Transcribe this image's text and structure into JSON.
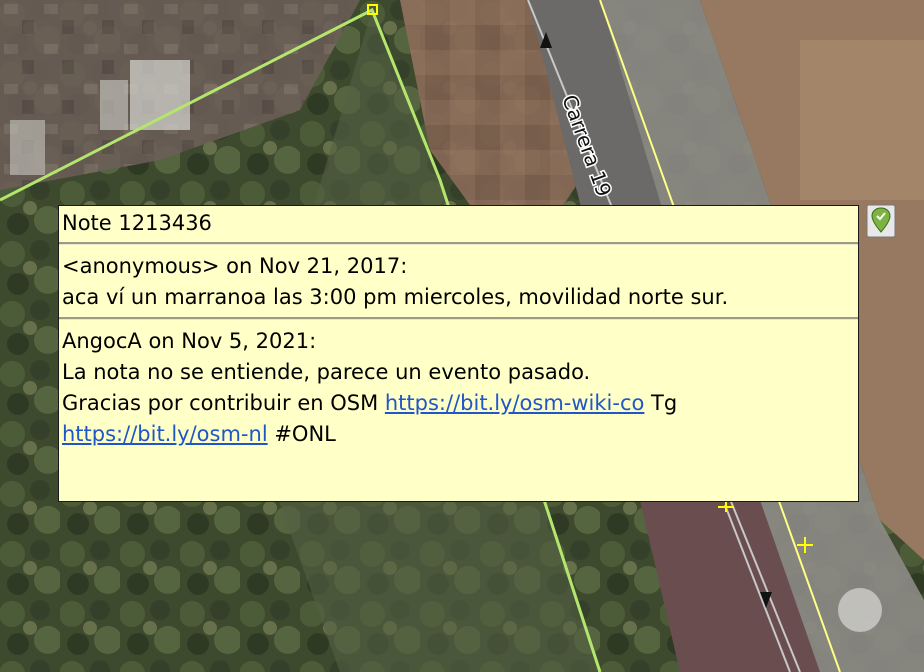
{
  "map": {
    "street_name": "Carrera 19",
    "colors": {
      "polygon_outline": "#b4e66e",
      "road_centerline": "#ffff88",
      "way_line": "#c8c8c8",
      "node": "#ffff00"
    }
  },
  "note": {
    "title": "Note 1213436",
    "comments": [
      {
        "header": "<anonymous> on Nov 21, 2017:",
        "lines": [
          "aca ví un marranoa las 3:00 pm miercoles, movilidad norte sur."
        ]
      },
      {
        "header": "AngocA on Nov 5, 2021:",
        "line1": "La nota no se entiende, parece un evento pasado.",
        "line2_text": "Gracias por contribuir en OSM ",
        "link1": "https://bit.ly/osm-wiki-co",
        "line2_suffix": " Tg",
        "link2": "https://bit.ly/osm-nl",
        "line3_suffix": " #ONL"
      }
    ],
    "background_color": "#ffffc8",
    "link_color": "#1f56c9"
  },
  "note_marker": {
    "icon": "note-closed-marker-icon",
    "status": "closed",
    "color": "#7cb342"
  }
}
